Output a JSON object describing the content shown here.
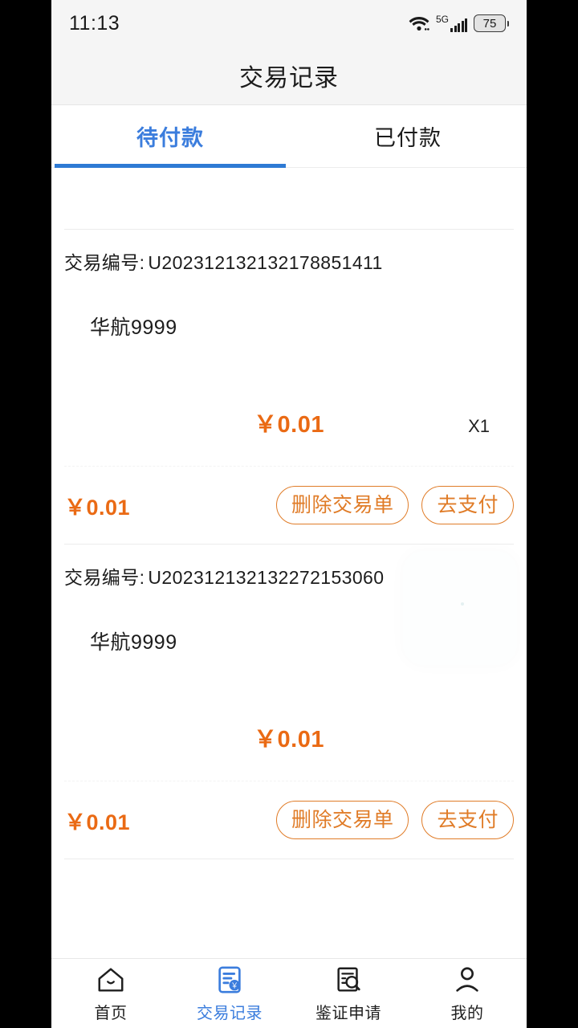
{
  "status_bar": {
    "time": "11:13",
    "network_label": "5G",
    "battery_level": "75",
    "icons": [
      "wifi-icon",
      "cellular-signal-icon",
      "battery-icon"
    ]
  },
  "header": {
    "title": "交易记录"
  },
  "tabs": [
    {
      "label": "待付款",
      "active": true
    },
    {
      "label": "已付款",
      "active": false
    }
  ],
  "orders": [
    {
      "order_no_label": "交易编号:",
      "order_no_value": "U202312132132178851411",
      "goods_name": "华航9999",
      "goods_price": "￥0.01",
      "quantity": "X1",
      "total_price": "￥0.01",
      "delete_label": "删除交易单",
      "pay_label": "去支付"
    },
    {
      "order_no_label": "交易编号:",
      "order_no_value": "U202312132132272153060",
      "goods_name": "华航9999",
      "goods_price": "￥0.01",
      "quantity": "",
      "total_price": "￥0.01",
      "delete_label": "删除交易单",
      "pay_label": "去支付"
    }
  ],
  "bottom_nav": [
    {
      "label": "首页",
      "icon": "home-icon",
      "active": false
    },
    {
      "label": "交易记录",
      "icon": "document-yuan-icon",
      "active": true
    },
    {
      "label": "鉴证申请",
      "icon": "document-search-icon",
      "active": false
    },
    {
      "label": "我的",
      "icon": "person-icon",
      "active": false
    }
  ],
  "colors": {
    "accent_blue": "#3b7ddd",
    "accent_orange": "#ea6a14",
    "button_border_orange": "#e07c28",
    "header_bg": "#f5f5f5"
  }
}
